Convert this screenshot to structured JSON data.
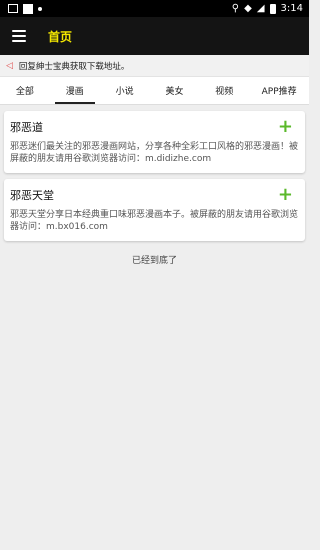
{
  "status_bar": {
    "time": "3:14",
    "icons": [
      "image-icon",
      "square-icon",
      "dot-icon",
      "location-icon",
      "wifi-icon",
      "signal-icon",
      "battery-icon"
    ]
  },
  "app_bar": {
    "title": "首页"
  },
  "notice": {
    "text": "回复绅士宝典获取下载地址。"
  },
  "tabs": [
    {
      "label": "全部",
      "active": false
    },
    {
      "label": "漫画",
      "active": true
    },
    {
      "label": "小说",
      "active": false
    },
    {
      "label": "美女",
      "active": false
    },
    {
      "label": "视频",
      "active": false
    },
    {
      "label": "APP推荐",
      "active": false
    }
  ],
  "cards": [
    {
      "title": "邪恶道",
      "description": "邪恶迷们最关注的邪恶漫画网站，分享各种全彩工口风格的邪恶漫画！被屏蔽的朋友请用谷歌浏览器访问：m.didizhe.com"
    },
    {
      "title": "邪恶天堂",
      "description": "邪恶天堂分享日本经典重口味邪恶漫画本子。被屏蔽的朋友请用谷歌浏览器访问：m.bx016.com"
    }
  ],
  "end_text": "已经到底了",
  "colors": {
    "accent_yellow": "#f5e800",
    "add_green": "#5ab82a",
    "app_bar_bg": "#141414"
  }
}
